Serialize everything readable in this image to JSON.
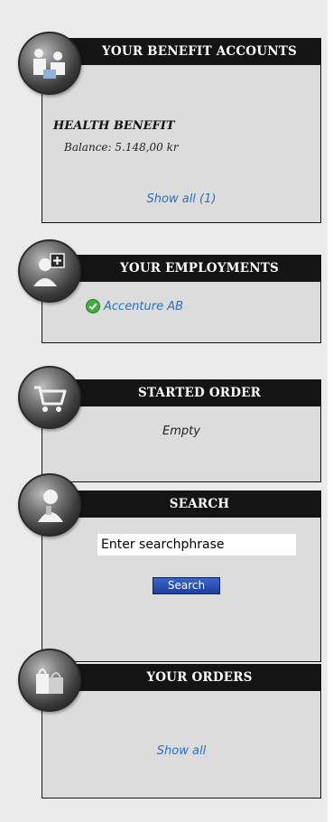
{
  "benefit_accounts": {
    "title": "YOUR BENEFIT ACCOUNTS",
    "account_name": "HEALTH BENEFIT",
    "balance": "Balance: 5.148,00 kr",
    "show_all": "Show all (1)"
  },
  "employments": {
    "title": "YOUR EMPLOYMENTS",
    "company": "Accenture AB",
    "status_icon": "check-circle-icon"
  },
  "started_order": {
    "title": "STARTED ORDER",
    "status": "Empty"
  },
  "search": {
    "title": "SEARCH",
    "input_value": "Enter searchphrase",
    "button_label": "Search"
  },
  "orders": {
    "title": "YOUR ORDERS",
    "show_all": "Show all"
  },
  "colors": {
    "header_bg": "#141414",
    "body_bg": "#dcdcdc",
    "link": "#2a6fbf",
    "button": "#1d3f9e"
  }
}
